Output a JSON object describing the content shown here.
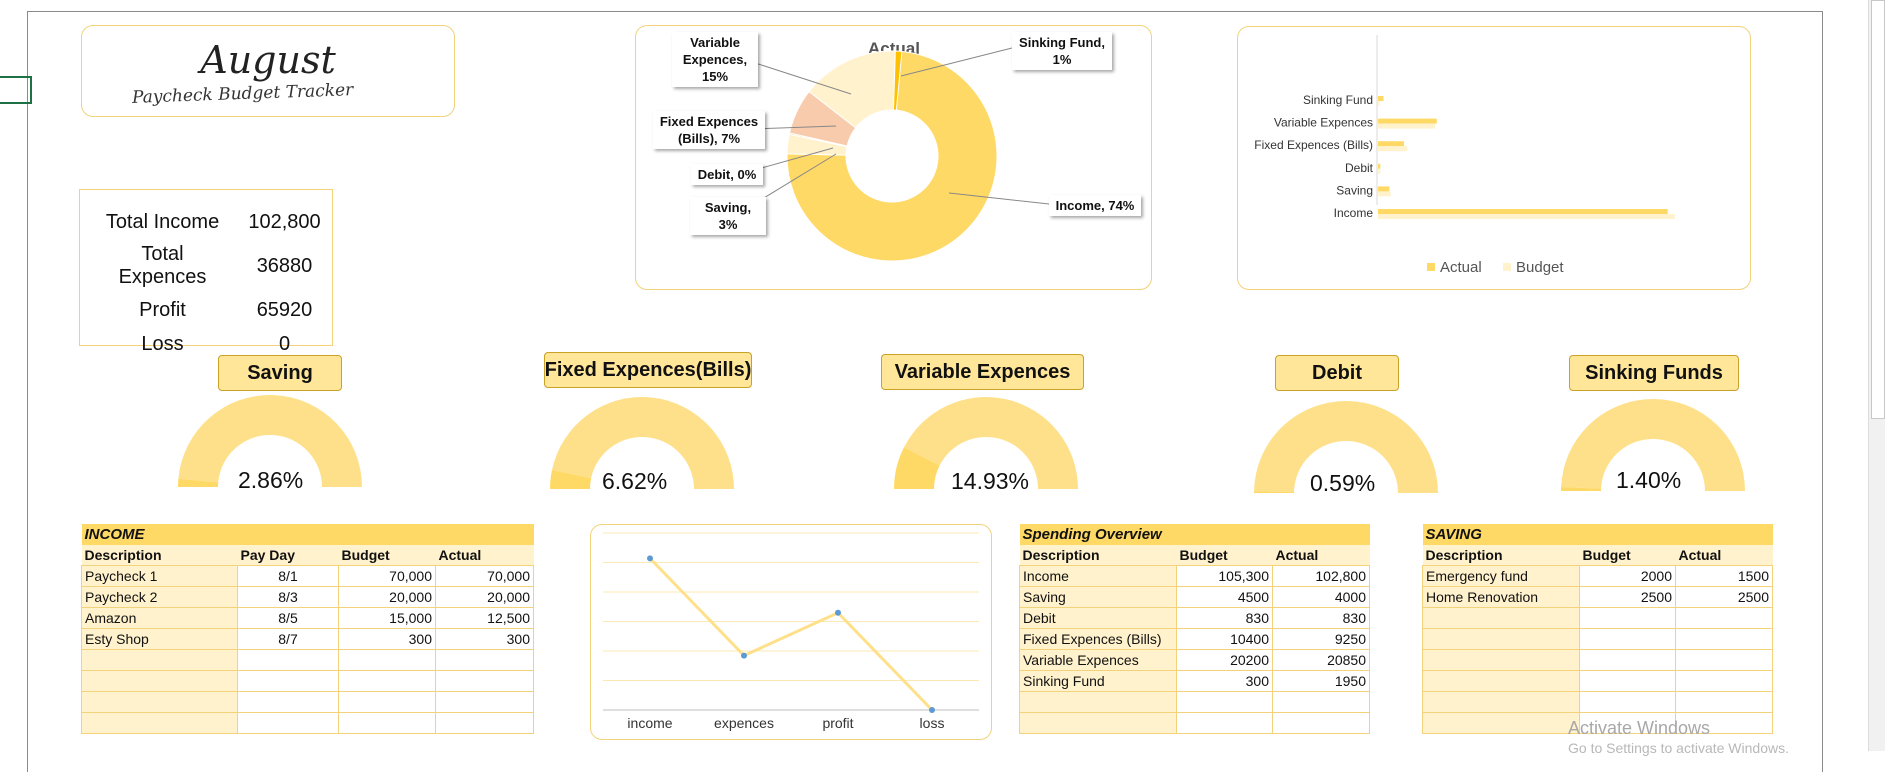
{
  "title": {
    "month": "August",
    "subtitle": "Paycheck Budget Tracker"
  },
  "summary": [
    {
      "label": "Total Income",
      "value": "102,800"
    },
    {
      "label": "Total Expences",
      "value": "36880"
    },
    {
      "label": "Profit",
      "value": "65920"
    },
    {
      "label": "Loss",
      "value": "0"
    }
  ],
  "colors": {
    "accent": "#ffd966",
    "light": "#fff2cc",
    "border": "#f2d27a",
    "dark": "#ffc000",
    "peach": "#f8cbad",
    "line": "#ffe08a",
    "marker": "#5b9bd5"
  },
  "chart_data": [
    {
      "type": "pie",
      "title": "Actual",
      "categories": [
        "Income",
        "Saving",
        "Debit",
        "Fixed Expences (Bills)",
        "Variable Expences",
        "Sinking Fund"
      ],
      "values": [
        74,
        3,
        0,
        7,
        15,
        1
      ],
      "labels": [
        "Income, 74%",
        "Saving, 3%",
        "Debit, 0%",
        "Fixed Expences (Bills), 7%",
        "Variable Expences, 15%",
        "Sinking Fund, 1%"
      ],
      "label_lines": {
        "income": [
          "Income, 74%"
        ],
        "saving": [
          "Saving, 3%"
        ],
        "debit": [
          "Debit, 0%"
        ],
        "fixed": [
          "Fixed Expences",
          "(Bills), 7%"
        ],
        "variable": [
          "Variable",
          "Expences,",
          "15%"
        ],
        "sinking": [
          "Sinking Fund,",
          "1%"
        ]
      }
    },
    {
      "type": "bar",
      "orientation": "horizontal",
      "categories": [
        "Sinking Fund",
        "Variable Expences",
        "Fixed Expences (Bills)",
        "Debit",
        "Saving",
        "Income"
      ],
      "series": [
        {
          "name": "Actual",
          "values": [
            1950,
            20850,
            9250,
            830,
            4000,
            102800
          ]
        },
        {
          "name": "Budget",
          "values": [
            300,
            20200,
            10400,
            830,
            4500,
            105300
          ]
        }
      ],
      "xlim": [
        0,
        110000
      ],
      "legend": "bottom"
    },
    {
      "type": "line",
      "categories": [
        "income",
        "expences",
        "profit",
        "loss"
      ],
      "values": [
        102800,
        36880,
        65920,
        0
      ],
      "ylim": [
        0,
        120000
      ],
      "grid": true
    }
  ],
  "gauges": [
    {
      "key": "saving",
      "label": "Saving",
      "pct_text": "2.86%",
      "fraction": 0.0286
    },
    {
      "key": "fixed",
      "label": "Fixed Expences(Bills)",
      "pct_text": "6.62%",
      "fraction": 0.0662
    },
    {
      "key": "variable",
      "label": "Variable Expences",
      "pct_text": "14.93%",
      "fraction": 0.1493
    },
    {
      "key": "debit",
      "label": "Debit",
      "pct_text": "0.59%",
      "fraction": 0.0059
    },
    {
      "key": "sinking",
      "label": "Sinking Funds",
      "pct_text": "1.40%",
      "fraction": 0.014
    }
  ],
  "income_table": {
    "title": "INCOME",
    "columns": [
      "Description",
      "Pay Day",
      "Budget",
      "Actual"
    ],
    "rows": [
      [
        "Paycheck 1",
        "8/1",
        "70,000",
        "70,000"
      ],
      [
        "Paycheck 2",
        "8/3",
        "20,000",
        "20,000"
      ],
      [
        "Amazon",
        "8/5",
        "15,000",
        "12,500"
      ],
      [
        "Esty Shop",
        "8/7",
        "300",
        "300"
      ]
    ]
  },
  "spending_table": {
    "title": "Spending Overview",
    "columns": [
      "Description",
      "Budget",
      "Actual"
    ],
    "rows": [
      [
        "Income",
        "105,300",
        "102,800"
      ],
      [
        "Saving",
        "4500",
        "4000"
      ],
      [
        "Debit",
        "830",
        "830"
      ],
      [
        "Fixed Expences (Bills)",
        "10400",
        "9250"
      ],
      [
        "Variable Expences",
        "20200",
        "20850"
      ],
      [
        "Sinking Fund",
        "300",
        "1950"
      ]
    ]
  },
  "saving_table": {
    "title": "SAVING",
    "columns": [
      "Description",
      "Budget",
      "Actual"
    ],
    "rows": [
      [
        "Emergency fund",
        "2000",
        "1500"
      ],
      [
        "Home Renovation",
        "2500",
        "2500"
      ]
    ]
  },
  "watermark": {
    "line1": "Activate Windows",
    "line2": "Go to Settings to activate Windows."
  }
}
